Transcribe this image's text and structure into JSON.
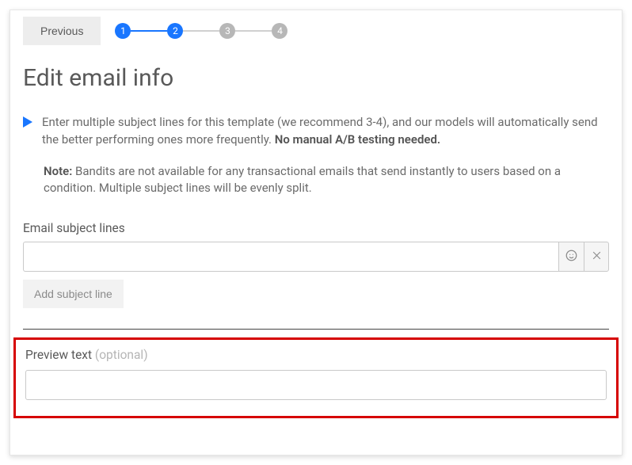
{
  "topbar": {
    "previous_label": "Previous",
    "steps": [
      "1",
      "2",
      "3",
      "4"
    ]
  },
  "title": "Edit email info",
  "info": {
    "line1_a": "Enter multiple subject lines for this template (we recommend 3-4), and our models will automatically send the better performing ones more frequently. ",
    "line1_bold": "No manual A/B testing needed."
  },
  "note": {
    "label": "Note:",
    "text": " Bandits are not available for any transactional emails that send instantly to users based on a condition. Multiple subject lines will be evenly split."
  },
  "subject": {
    "label": "Email subject lines",
    "value": "",
    "add_button": "Add subject line"
  },
  "preview": {
    "label": "Preview text ",
    "optional": "(optional)",
    "value": ""
  },
  "colors": {
    "accent": "#1976ff",
    "highlight_border": "#d60000"
  }
}
